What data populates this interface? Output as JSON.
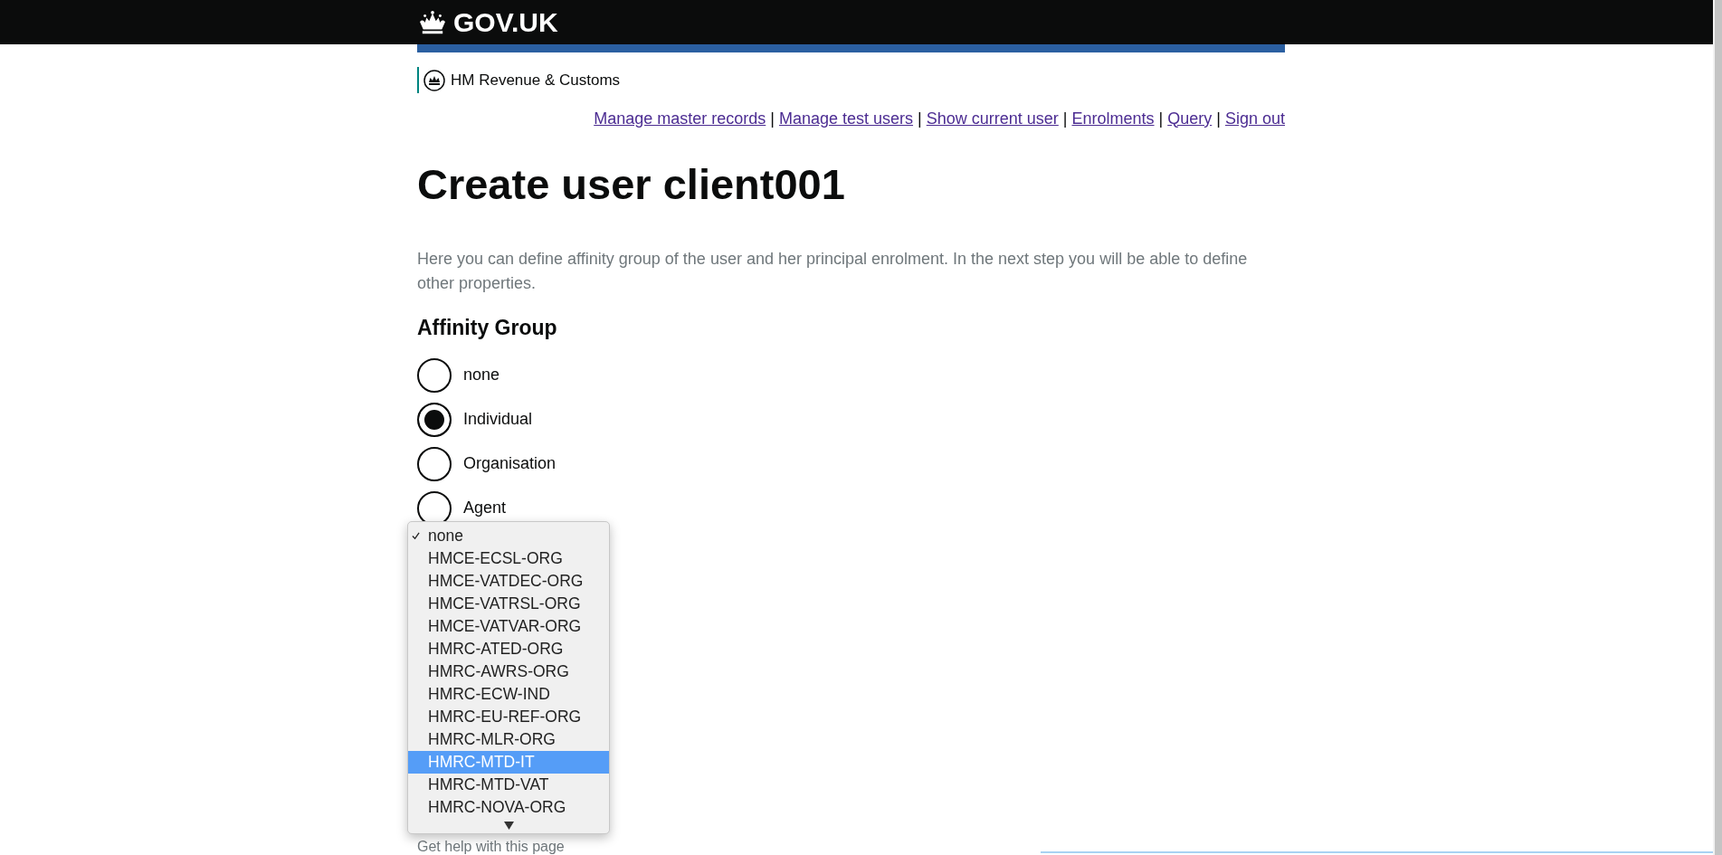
{
  "header": {
    "logo_text": "GOV.UK",
    "department": "HM Revenue & Customs"
  },
  "nav_links": [
    {
      "label": "Manage master records"
    },
    {
      "separator": "|",
      "label": "Manage test users"
    },
    {
      "separator": "|",
      "label": "Show current user"
    },
    {
      "separator": "|",
      "label": "Enrolments"
    },
    {
      "separator": "|",
      "label": "Query"
    },
    {
      "separator": "|",
      "label": "Sign out"
    }
  ],
  "title": "Create user client001",
  "intro": "Here you can define affinity group of the user and her principal enrolment. In the next step you will be able to define other properties.",
  "affinity_group": {
    "heading": "Affinity Group",
    "options": [
      {
        "label": "none",
        "selected": false
      },
      {
        "label": "Individual",
        "selected": true
      },
      {
        "label": "Organisation",
        "selected": false
      },
      {
        "label": "Agent",
        "selected": false
      }
    ]
  },
  "select_menu": {
    "options": [
      {
        "label": "none",
        "checked": true,
        "highlighted": false
      },
      {
        "label": "HMCE-ECSL-ORG",
        "checked": false,
        "highlighted": false
      },
      {
        "label": "HMCE-VATDEC-ORG",
        "checked": false,
        "highlighted": false
      },
      {
        "label": "HMCE-VATRSL-ORG",
        "checked": false,
        "highlighted": false
      },
      {
        "label": "HMCE-VATVAR-ORG",
        "checked": false,
        "highlighted": false
      },
      {
        "label": "HMRC-ATED-ORG",
        "checked": false,
        "highlighted": false
      },
      {
        "label": "HMRC-AWRS-ORG",
        "checked": false,
        "highlighted": false
      },
      {
        "label": "HMRC-ECW-IND",
        "checked": false,
        "highlighted": false
      },
      {
        "label": "HMRC-EU-REF-ORG",
        "checked": false,
        "highlighted": false
      },
      {
        "label": "HMRC-MLR-ORG",
        "checked": false,
        "highlighted": false
      },
      {
        "label": "HMRC-MTD-IT",
        "checked": false,
        "highlighted": true
      },
      {
        "label": "HMRC-MTD-VAT",
        "checked": false,
        "highlighted": false
      },
      {
        "label": "HMRC-NOVA-ORG",
        "checked": false,
        "highlighted": false
      }
    ],
    "more_below": true
  },
  "help_link": "Get help with this page"
}
